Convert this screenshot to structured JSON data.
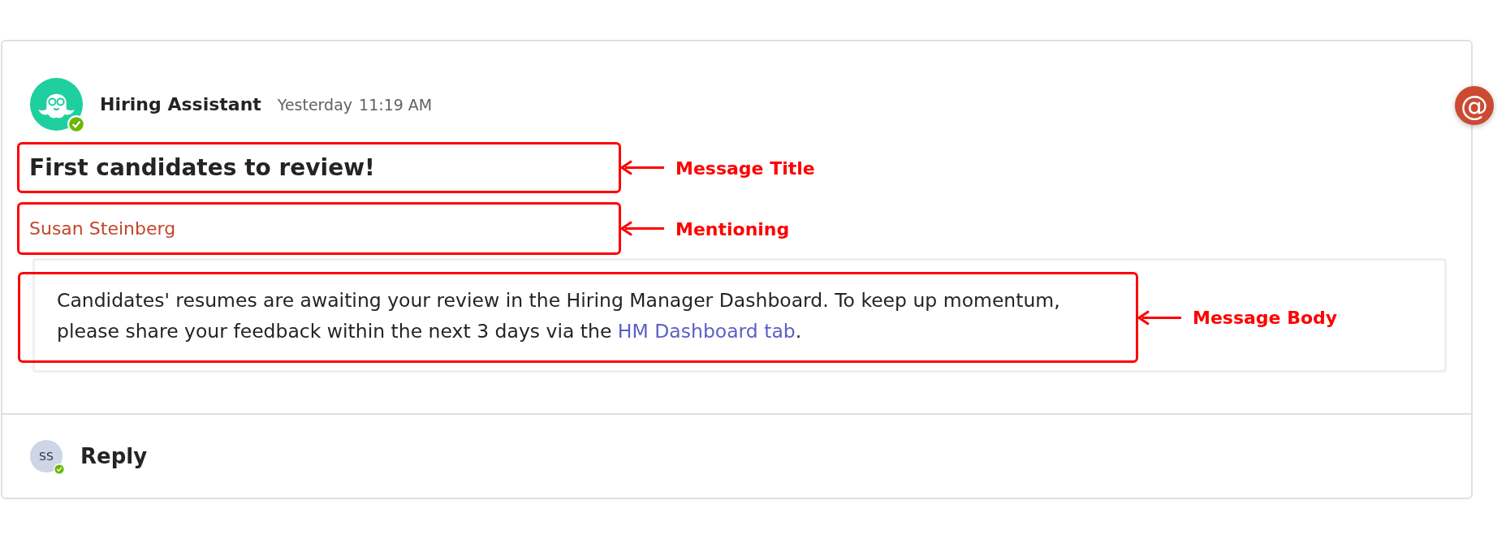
{
  "message": {
    "sender": "Hiring Assistant",
    "day": "Yesterday",
    "time": "11:19 AM",
    "sender_available": true,
    "title": "First candidates to review!",
    "mention": "Susan Steinberg",
    "body": {
      "text": "Candidates' resumes are awaiting your review in the Hiring Manager Dashboard. To keep up momentum, please share your feedback within the next 3 days via the ",
      "link": "HM Dashboard tab",
      "after": "."
    }
  },
  "mention_badge": {
    "symbol": "@"
  },
  "reply": {
    "initials": "SS",
    "available": true,
    "label": "Reply"
  },
  "annotations": [
    {
      "label": "Message Title"
    },
    {
      "label": "Mentioning"
    },
    {
      "label": "Message Body"
    }
  ]
}
